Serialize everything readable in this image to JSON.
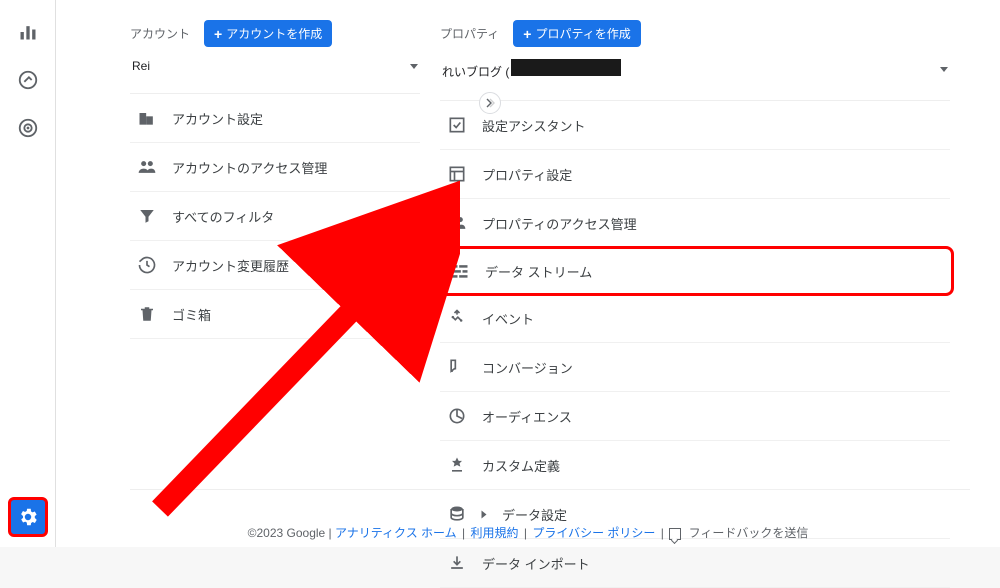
{
  "sidebar_icons": [
    "bar-chart",
    "target",
    "advertising"
  ],
  "account_col": {
    "label": "アカウント",
    "create_btn": "アカウントを作成",
    "selector": "Rei",
    "items": [
      "アカウント設定",
      "アカウントのアクセス管理",
      "すべてのフィルタ",
      "アカウント変更履歴",
      "ゴミ箱"
    ]
  },
  "property_col": {
    "label": "プロパティ",
    "create_btn": "プロパティを作成",
    "selector_prefix": "れいブログ (",
    "items": [
      {
        "label": "設定アシスタント",
        "sub": false
      },
      {
        "label": "プロパティ設定",
        "sub": false
      },
      {
        "label": "プロパティのアクセス管理",
        "sub": false
      },
      {
        "label": "データ ストリーム",
        "sub": false,
        "highlight": true
      },
      {
        "label": "イベント",
        "sub": false
      },
      {
        "label": "コンバージョン",
        "sub": false
      },
      {
        "label": "オーディエンス",
        "sub": false
      },
      {
        "label": "カスタム定義",
        "sub": false
      },
      {
        "label": "データ設定",
        "sub": true
      },
      {
        "label": "データ インポート",
        "sub": false
      }
    ]
  },
  "footer": {
    "copyright": "©2023 Google |",
    "home": "アナリティクス ホーム",
    "terms": "利用規約",
    "privacy": "プライバシー ポリシー",
    "feedback": "フィードバックを送信"
  }
}
